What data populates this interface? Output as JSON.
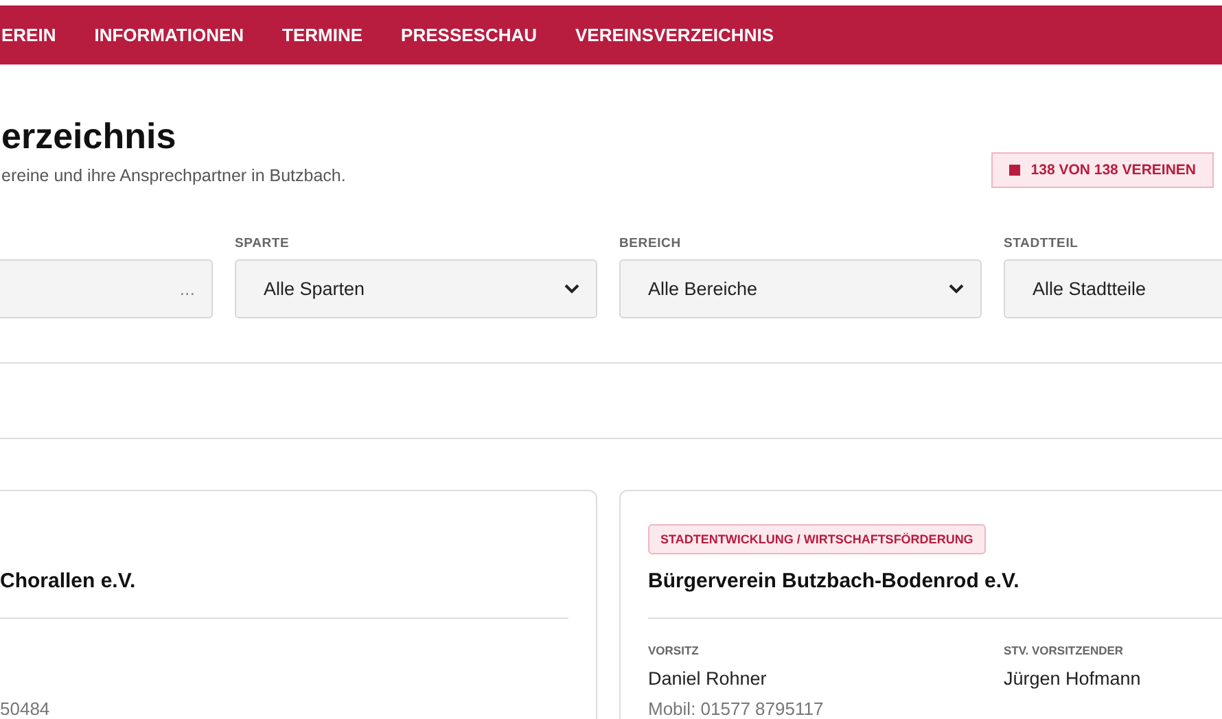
{
  "nav": {
    "items": [
      {
        "label": "EREIN"
      },
      {
        "label": "INFORMATIONEN"
      },
      {
        "label": "TERMINE"
      },
      {
        "label": "PRESSESCHAU"
      },
      {
        "label": "VEREINSVERZEICHNIS"
      }
    ]
  },
  "header": {
    "title": "erzeichnis",
    "subtitle": "ereine und ihre Ansprechpartner in Butzbach.",
    "counter": "138 VON 138 VEREINEN"
  },
  "filters": [
    {
      "kind": "search",
      "placeholder": "..."
    },
    {
      "kind": "select",
      "label": "SPARTE",
      "value": "Alle Sparten"
    },
    {
      "kind": "select",
      "label": "BEREICH",
      "value": "Alle Bereiche"
    },
    {
      "kind": "select",
      "label": "STADTTEIL",
      "value": "Alle Stadtteile"
    }
  ],
  "cards": [
    {
      "title": "Chorallen e.V.",
      "contacts": [
        {
          "phone": "50484"
        }
      ]
    },
    {
      "tag": "STADTENTWICKLUNG / WIRTSCHAFTSFÖRDERUNG",
      "title": "Bürgerverein Butzbach-Bodenrod e.V.",
      "contacts": [
        {
          "role": "VORSITZ",
          "name": "Daniel Rohner",
          "phone": "Mobil: 01577 8795117"
        },
        {
          "role": "STV. VORSITZENDER",
          "name": "Jürgen Hofmann"
        }
      ]
    }
  ]
}
